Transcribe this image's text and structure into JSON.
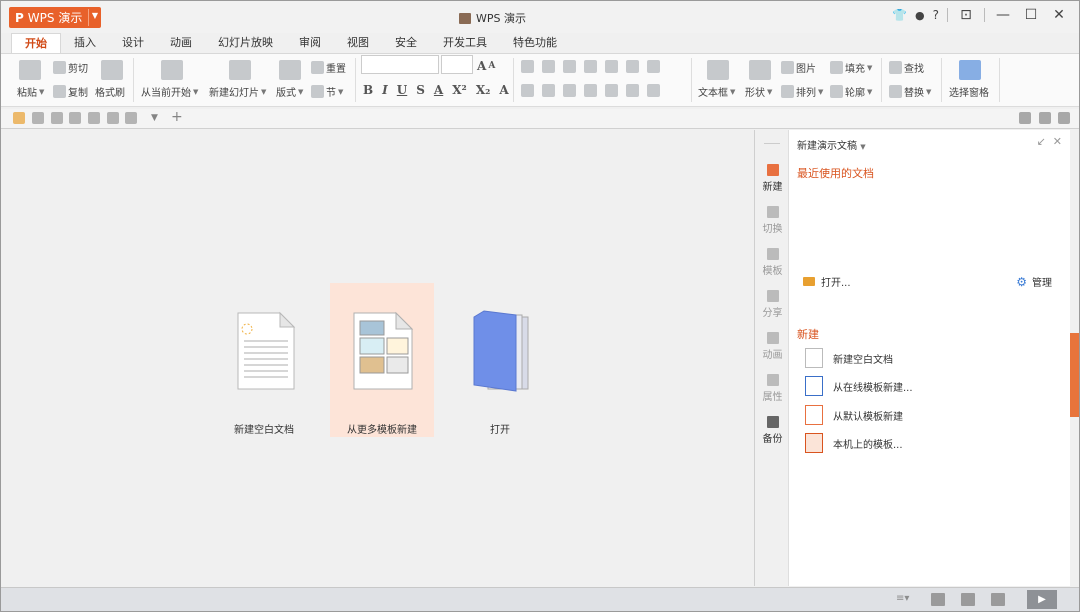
{
  "app": {
    "menu_label": "WPS 演示",
    "window_title": "WPS 演示",
    "help_label": "?"
  },
  "tabs": [
    "开始",
    "插入",
    "设计",
    "动画",
    "幻灯片放映",
    "审阅",
    "视图",
    "安全",
    "开发工具",
    "特色功能"
  ],
  "ribbon": {
    "paste": "粘贴",
    "cut": "剪切",
    "copy": "复制",
    "format_painter": "格式刷",
    "from_current": "从当前开始",
    "new_slide": "新建幻灯片",
    "layout": "版式",
    "reset": "重置",
    "section": "节",
    "textbox": "文本框",
    "shape": "形状",
    "picture": "图片",
    "arrange": "排列",
    "fill": "填充",
    "outline": "轮廓",
    "find": "查找",
    "replace": "替换",
    "selection_pane": "选择窗格",
    "font_name": "",
    "font_size": ""
  },
  "start": {
    "blank_label": "新建空白文档",
    "template_label": "从更多模板新建",
    "open_label": "打开"
  },
  "sidenav": [
    "新建",
    "切换",
    "模板",
    "分享",
    "动画",
    "属性",
    "备份"
  ],
  "taskpane": {
    "title": "新建演示文稿",
    "recent_heading": "最近使用的文档",
    "open_label": "打开...",
    "manage_label": "管理",
    "new_heading": "新建",
    "new_items": [
      "新建空白文档",
      "从在线模板新建...",
      "从默认模板新建",
      "本机上的模板..."
    ]
  },
  "colors": {
    "accent": "#e8612a",
    "accent_text": "#d9541f",
    "template_highlight": "#fde4d8"
  },
  "icons": {
    "folder": "folder-icon",
    "gear": "gear-icon",
    "play": "play-icon"
  }
}
